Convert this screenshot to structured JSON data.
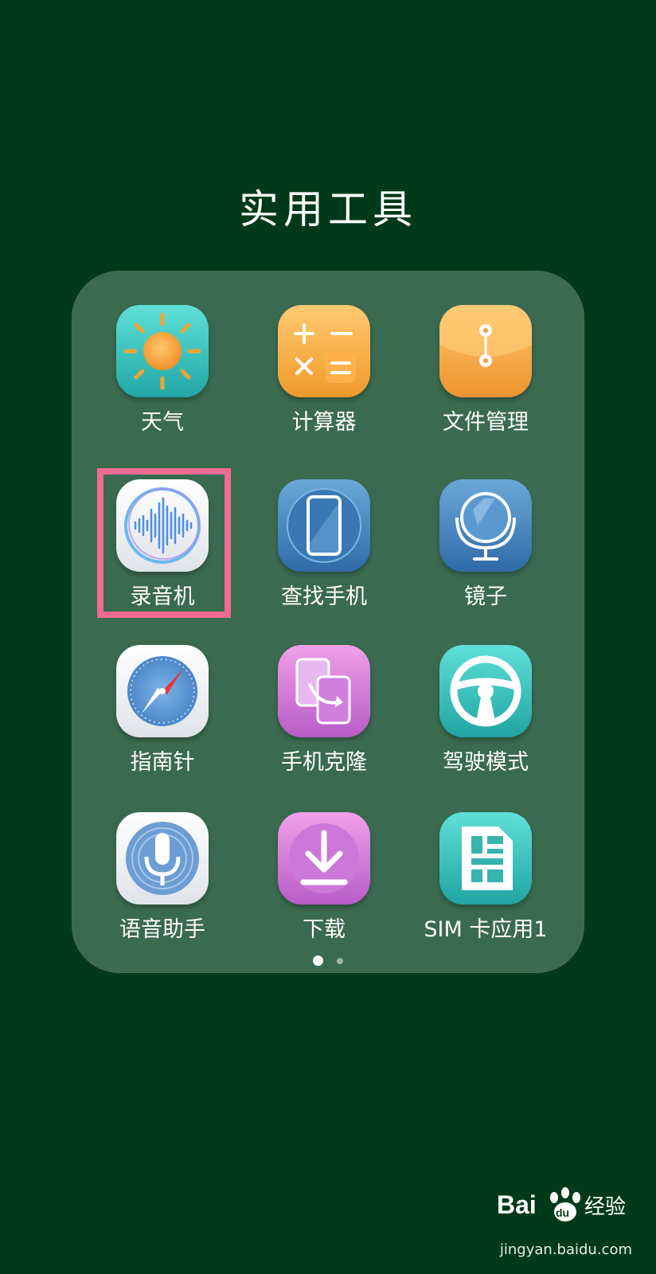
{
  "folder": {
    "title": "实用工具"
  },
  "apps": [
    {
      "label": "天气",
      "icon": "weather-sun-icon"
    },
    {
      "label": "计算器",
      "icon": "calculator-icon"
    },
    {
      "label": "文件管理",
      "icon": "file-manager-icon"
    },
    {
      "label": "录音机",
      "icon": "recorder-waveform-icon"
    },
    {
      "label": "查找手机",
      "icon": "find-phone-icon"
    },
    {
      "label": "镜子",
      "icon": "mirror-icon"
    },
    {
      "label": "指南针",
      "icon": "compass-icon"
    },
    {
      "label": "手机克隆",
      "icon": "phone-clone-icon"
    },
    {
      "label": "驾驶模式",
      "icon": "steering-wheel-icon"
    },
    {
      "label": "语音助手",
      "icon": "microphone-icon"
    },
    {
      "label": "下载",
      "icon": "download-icon"
    },
    {
      "label": "SIM 卡应用1",
      "icon": "sim-card-icon"
    }
  ],
  "pagination": {
    "current_page": 1,
    "total_pages": 2
  },
  "highlight": {
    "target": "录音机",
    "color": "#ee6b93"
  },
  "watermark": {
    "logo": "Bai du 经验",
    "url": "jingyan.baidu.com"
  },
  "colors": {
    "background": "#013a1b",
    "panel": "#3a6a50"
  }
}
